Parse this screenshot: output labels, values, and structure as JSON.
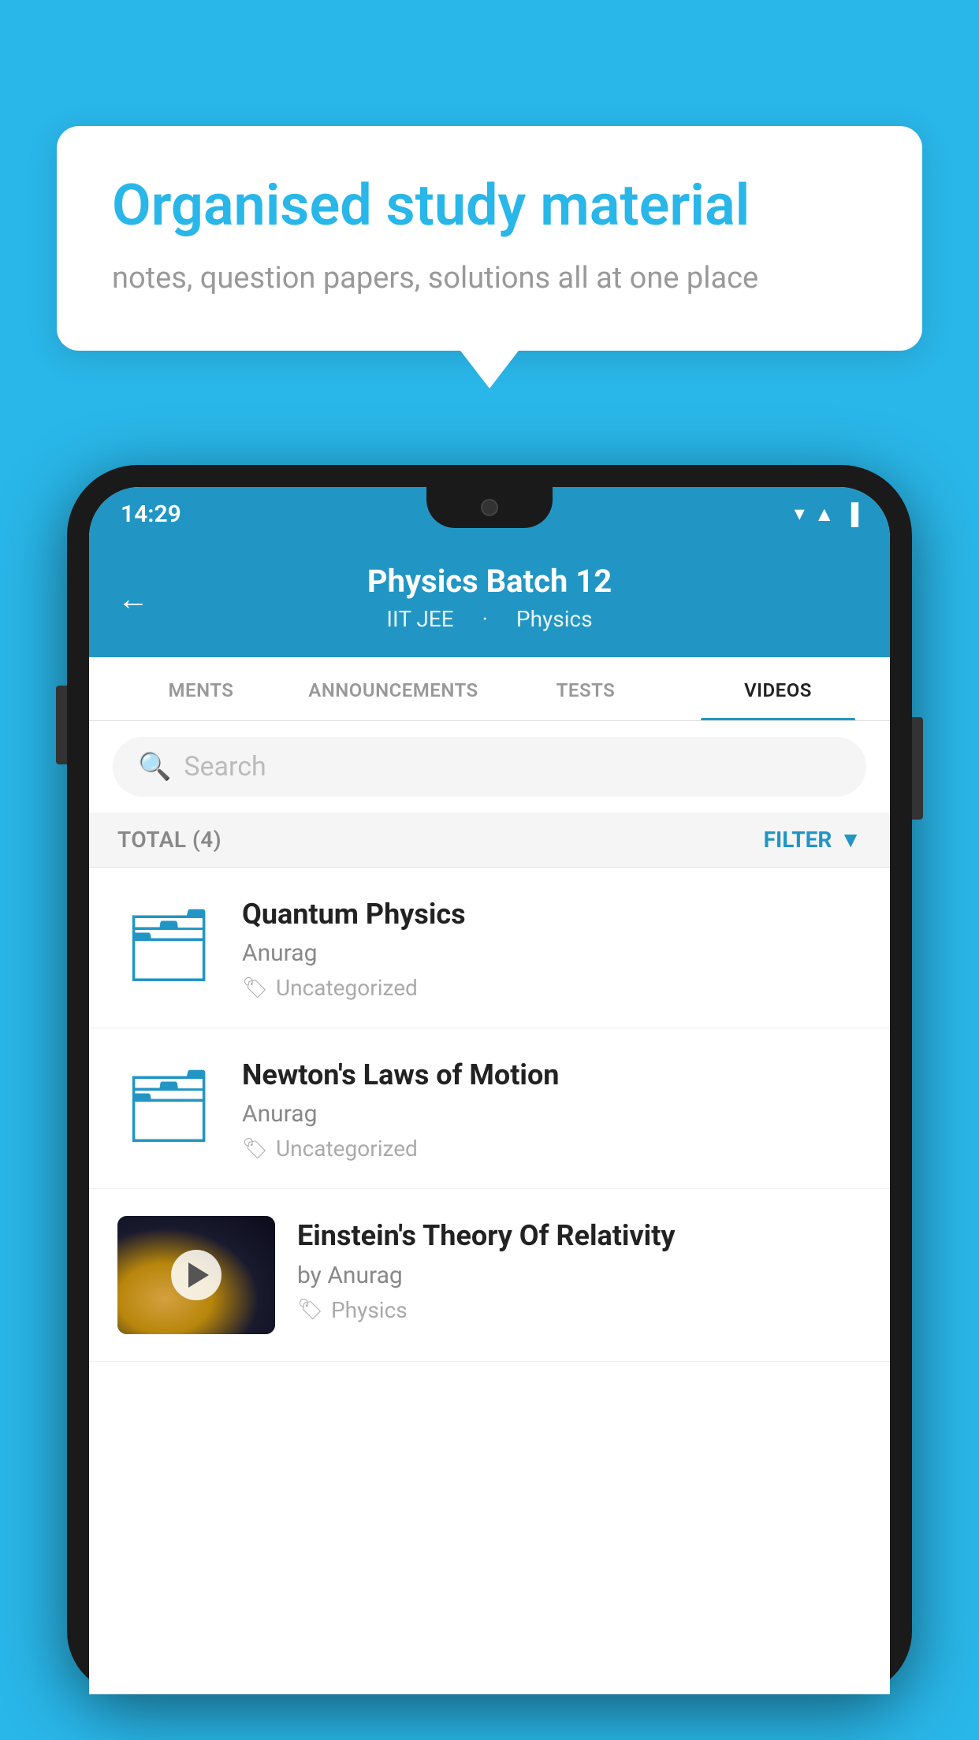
{
  "background_color": "#29b6e8",
  "speech_bubble": {
    "title": "Organised study material",
    "subtitle": "notes, question papers, solutions all at one place"
  },
  "phone": {
    "status_bar": {
      "time": "14:29",
      "icons": [
        "▼",
        "▲",
        "▌"
      ]
    },
    "header": {
      "title": "Physics Batch 12",
      "subtitle_left": "IIT JEE",
      "subtitle_right": "Physics",
      "back_label": "←"
    },
    "tabs": [
      {
        "label": "MENTS",
        "active": false
      },
      {
        "label": "ANNOUNCEMENTS",
        "active": false
      },
      {
        "label": "TESTS",
        "active": false
      },
      {
        "label": "VIDEOS",
        "active": true
      }
    ],
    "search": {
      "placeholder": "Search"
    },
    "filter_row": {
      "total": "TOTAL (4)",
      "filter_label": "FILTER"
    },
    "videos": [
      {
        "id": 1,
        "title": "Quantum Physics",
        "author": "Anurag",
        "tag": "Uncategorized",
        "type": "folder"
      },
      {
        "id": 2,
        "title": "Newton's Laws of Motion",
        "author": "Anurag",
        "tag": "Uncategorized",
        "type": "folder"
      },
      {
        "id": 3,
        "title": "Einstein's Theory Of Relativity",
        "author": "by Anurag",
        "tag": "Physics",
        "type": "video"
      }
    ]
  }
}
